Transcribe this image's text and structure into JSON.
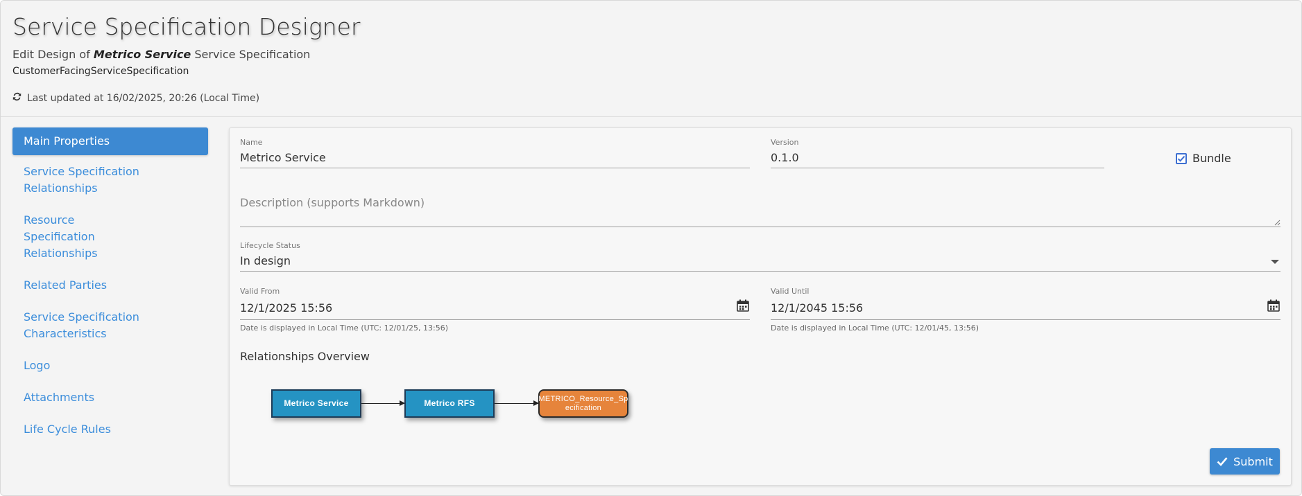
{
  "header": {
    "title": "Service Specification Designer",
    "subtitle_prefix": "Edit Design of",
    "subtitle_name": "Metrico Service",
    "subtitle_suffix": "Service Specification",
    "spec_type": "CustomerFacingServiceSpecification",
    "last_updated": "Last updated at 16/02/2025, 20:26 (Local Time)",
    "refresh_icon": "refresh-icon"
  },
  "sidebar": {
    "items": [
      {
        "label": "Main Properties",
        "active": true
      },
      {
        "label": "Service Specification Relationships",
        "active": false
      },
      {
        "label": "Resource Specification Relationships",
        "active": false
      },
      {
        "label": "Related Parties",
        "active": false
      },
      {
        "label": "Service Specification Characteristics",
        "active": false
      },
      {
        "label": "Logo",
        "active": false
      },
      {
        "label": "Attachments",
        "active": false
      },
      {
        "label": "Life Cycle Rules",
        "active": false
      }
    ]
  },
  "form": {
    "name": {
      "label": "Name",
      "value": "Metrico Service"
    },
    "version": {
      "label": "Version",
      "value": "0.1.0"
    },
    "bundle": {
      "label": "Bundle",
      "checked": true
    },
    "description": {
      "placeholder": "Description (supports Markdown)",
      "value": ""
    },
    "lifecycle_status": {
      "label": "Lifecycle Status",
      "value": "In design"
    },
    "valid_from": {
      "label": "Valid From",
      "value": "12/1/2025 15:56",
      "hint": "Date is displayed in Local Time (UTC: 12/01/25, 13:56)"
    },
    "valid_until": {
      "label": "Valid Until",
      "value": "12/1/2045 15:56",
      "hint": "Date is displayed in Local Time (UTC: 12/01/45, 13:56)"
    }
  },
  "relationships": {
    "title": "Relationships Overview",
    "nodes": [
      {
        "label": "Metrico Service",
        "color": "#2593c3"
      },
      {
        "label": "Metrico RFS",
        "color": "#2593c3"
      },
      {
        "label": "METRICO_Resource_Specification",
        "label_line1": "METRICO_Resource_Sp",
        "label_line2": "ecification",
        "color": "#e6843b"
      }
    ]
  },
  "actions": {
    "submit_label": "Submit"
  },
  "colors": {
    "accent": "#3d89d2",
    "link": "#3b8ddb",
    "node_blue": "#2593c3",
    "node_orange": "#e6843b"
  }
}
